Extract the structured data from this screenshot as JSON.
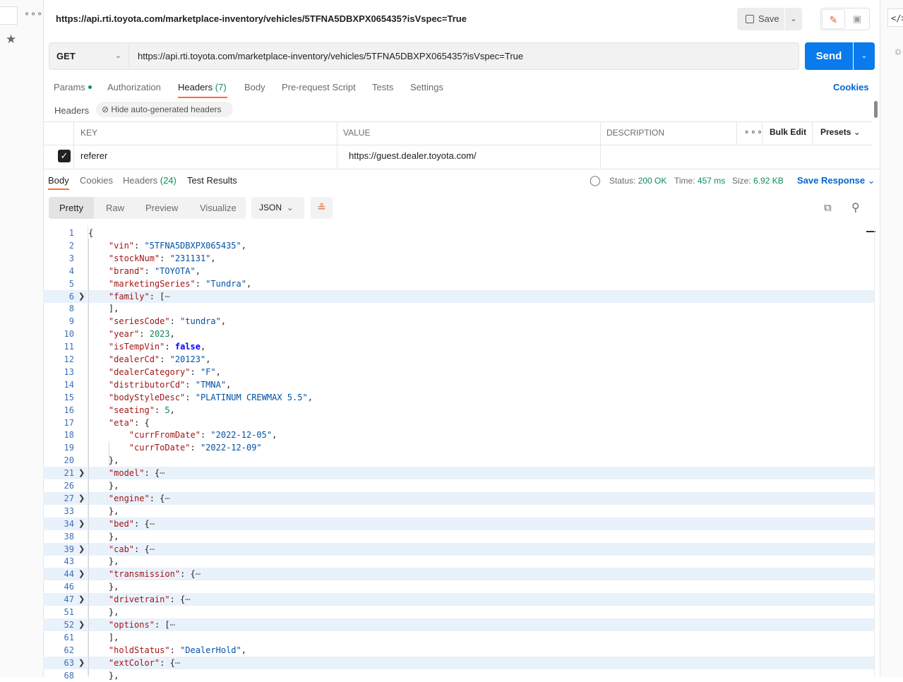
{
  "window": {
    "title": "https://api.rti.toyota.com/marketplace-inventory/vehicles/5TFNA5DBXPX065435?isVspec=True"
  },
  "toolbar": {
    "save_label": "Save",
    "code_label": "</>"
  },
  "request": {
    "method": "GET",
    "url": "https://api.rti.toyota.com/marketplace-inventory/vehicles/5TFNA5DBXPX065435?isVspec=True",
    "send_label": "Send"
  },
  "request_tabs": {
    "params": "Params",
    "authorization": "Authorization",
    "headers": "Headers",
    "headers_count": "(7)",
    "body": "Body",
    "prerequest": "Pre-request Script",
    "tests": "Tests",
    "settings": "Settings",
    "cookies": "Cookies"
  },
  "headers_section": {
    "label": "Headers",
    "hide_auto": "Hide auto-generated headers",
    "columns": {
      "key": "KEY",
      "value": "VALUE",
      "description": "DESCRIPTION"
    },
    "bulk_edit": "Bulk Edit",
    "presets": "Presets",
    "rows": [
      {
        "key": "referer",
        "value": "https://guest.dealer.toyota.com/",
        "checked": true
      }
    ]
  },
  "response_tabs": {
    "body": "Body",
    "cookies": "Cookies",
    "headers": "Headers",
    "headers_count": "(24)",
    "test_results": "Test Results"
  },
  "response_meta": {
    "status_label": "Status:",
    "status_value": "200 OK",
    "time_label": "Time:",
    "time_value": "457 ms",
    "size_label": "Size:",
    "size_value": "6.92 KB",
    "save_response": "Save Response"
  },
  "view": {
    "pretty": "Pretty",
    "raw": "Raw",
    "preview": "Preview",
    "visualize": "Visualize",
    "format": "JSON"
  },
  "code_lines": [
    {
      "n": "1",
      "t": "{"
    },
    {
      "n": "2",
      "t": "    \"vin\": \"5TFNA5DBXPX065435\","
    },
    {
      "n": "3",
      "t": "    \"stockNum\": \"231131\","
    },
    {
      "n": "4",
      "t": "    \"brand\": \"TOYOTA\","
    },
    {
      "n": "5",
      "t": "    \"marketingSeries\": \"Tundra\","
    },
    {
      "n": "6",
      "t": "    \"family\": [⋯",
      "fold": true
    },
    {
      "n": "8",
      "t": "    ],"
    },
    {
      "n": "9",
      "t": "    \"seriesCode\": \"tundra\","
    },
    {
      "n": "10",
      "t": "    \"year\": 2023,"
    },
    {
      "n": "11",
      "t": "    \"isTempVin\": false,"
    },
    {
      "n": "12",
      "t": "    \"dealerCd\": \"20123\","
    },
    {
      "n": "13",
      "t": "    \"dealerCategory\": \"F\","
    },
    {
      "n": "14",
      "t": "    \"distributorCd\": \"TMNA\","
    },
    {
      "n": "15",
      "t": "    \"bodyStyleDesc\": \"PLATINUM CREWMAX 5.5\","
    },
    {
      "n": "16",
      "t": "    \"seating\": 5,"
    },
    {
      "n": "17",
      "t": "    \"eta\": {"
    },
    {
      "n": "18",
      "t": "        \"currFromDate\": \"2022-12-05\","
    },
    {
      "n": "19",
      "t": "        \"currToDate\": \"2022-12-09\""
    },
    {
      "n": "20",
      "t": "    },"
    },
    {
      "n": "21",
      "t": "    \"model\": {⋯",
      "fold": true
    },
    {
      "n": "26",
      "t": "    },"
    },
    {
      "n": "27",
      "t": "    \"engine\": {⋯",
      "fold": true
    },
    {
      "n": "33",
      "t": "    },"
    },
    {
      "n": "34",
      "t": "    \"bed\": {⋯",
      "fold": true
    },
    {
      "n": "38",
      "t": "    },"
    },
    {
      "n": "39",
      "t": "    \"cab\": {⋯",
      "fold": true
    },
    {
      "n": "43",
      "t": "    },"
    },
    {
      "n": "44",
      "t": "    \"transmission\": {⋯",
      "fold": true
    },
    {
      "n": "46",
      "t": "    },"
    },
    {
      "n": "47",
      "t": "    \"drivetrain\": {⋯",
      "fold": true
    },
    {
      "n": "51",
      "t": "    },"
    },
    {
      "n": "52",
      "t": "    \"options\": [⋯",
      "fold": true
    },
    {
      "n": "61",
      "t": "    ],"
    },
    {
      "n": "62",
      "t": "    \"holdStatus\": \"DealerHold\","
    },
    {
      "n": "63",
      "t": "    \"extColor\": {⋯",
      "fold": true
    },
    {
      "n": "68",
      "t": "    },"
    }
  ],
  "colors": {
    "accent": "#ff6c37",
    "primary": "#097bed",
    "success": "#0c8f56",
    "link": "#0265d2",
    "json_key": "#a31515",
    "json_string": "#0451a5",
    "json_number": "#098658",
    "json_keyword": "#0000ff"
  }
}
